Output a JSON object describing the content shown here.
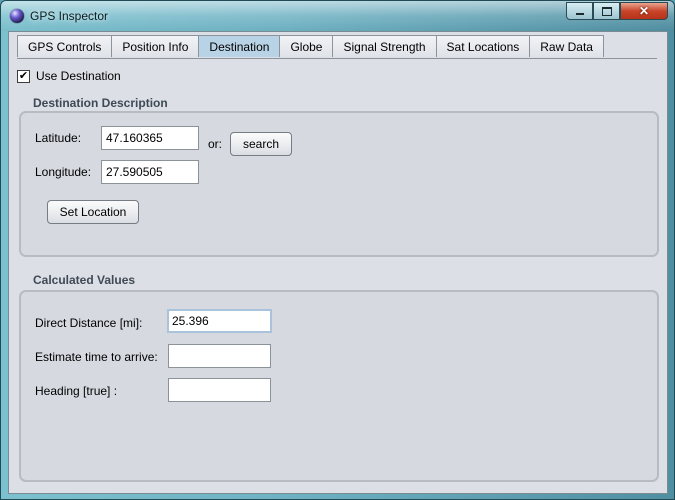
{
  "window": {
    "title": "GPS Inspector"
  },
  "tabs": [
    {
      "label": "GPS Controls",
      "active": false
    },
    {
      "label": "Position Info",
      "active": false
    },
    {
      "label": "Destination",
      "active": true
    },
    {
      "label": "Globe",
      "active": false
    },
    {
      "label": "Signal Strength",
      "active": false
    },
    {
      "label": "Sat Locations",
      "active": false
    },
    {
      "label": "Raw Data",
      "active": false
    }
  ],
  "use_destination": {
    "label": "Use Destination",
    "checked": true
  },
  "destination": {
    "title": "Destination Description",
    "latitude_label": "Latitude:",
    "latitude_value": "47.160365",
    "or_label": "or:",
    "search_label": "search",
    "longitude_label": "Longitude:",
    "longitude_value": "27.590505",
    "set_location_label": "Set Location"
  },
  "calculated": {
    "title": "Calculated Values",
    "direct_distance_label": "Direct Distance  [mi]:",
    "direct_distance_value": "25.396",
    "eta_label": "Estimate time to arrive:",
    "eta_value": "",
    "heading_label": "Heading [true] :",
    "heading_value": ""
  }
}
